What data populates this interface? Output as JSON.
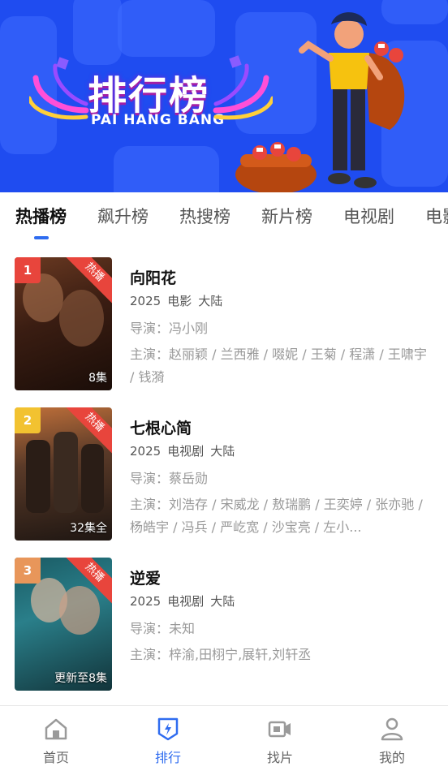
{
  "banner": {
    "title": "排行榜",
    "subtitle": "PAI HANG BANG"
  },
  "tabs": [
    "热播榜",
    "飙升榜",
    "热搜榜",
    "新片榜",
    "电视剧",
    "电影"
  ],
  "items": [
    {
      "rank": "1",
      "rank_color": "#e8453c",
      "badge": "热播",
      "poster_label": "8集",
      "title": "向阳花",
      "year": "2025",
      "type": "电影",
      "region": "大陆",
      "director": "导演：冯小刚",
      "cast": "主演：赵丽颖 / 兰西雅 / 啜妮 / 王菊 / 程潇 / 王啸宇 / 钱漪"
    },
    {
      "rank": "2",
      "rank_color": "#f2c230",
      "badge": "热播",
      "poster_label": "32集全",
      "title": "七根心简",
      "year": "2025",
      "type": "电视剧",
      "region": "大陆",
      "director": "导演：蔡岳勋",
      "cast": "主演：刘浩存 / 宋威龙 / 敖瑞鹏 / 王奕婷 / 张亦驰 / 杨皓宇 / 冯兵 / 严屹宽 / 沙宝亮 / 左小..."
    },
    {
      "rank": "3",
      "rank_color": "#e8965a",
      "badge": "热播",
      "poster_label": "更新至8集",
      "title": "逆爱",
      "year": "2025",
      "type": "电视剧",
      "region": "大陆",
      "director": "导演：未知",
      "cast": "主演：梓渝,田栩宁,展轩,刘轩丞"
    }
  ],
  "nav": [
    {
      "label": "首页",
      "icon": "home-icon"
    },
    {
      "label": "排行",
      "icon": "ranking-icon"
    },
    {
      "label": "找片",
      "icon": "video-camera-icon"
    },
    {
      "label": "我的",
      "icon": "user-icon"
    }
  ],
  "colors": {
    "banner_bg": "#1f4cf0",
    "accent": "#2f6cf0",
    "hot_badge": "#e8453c"
  }
}
